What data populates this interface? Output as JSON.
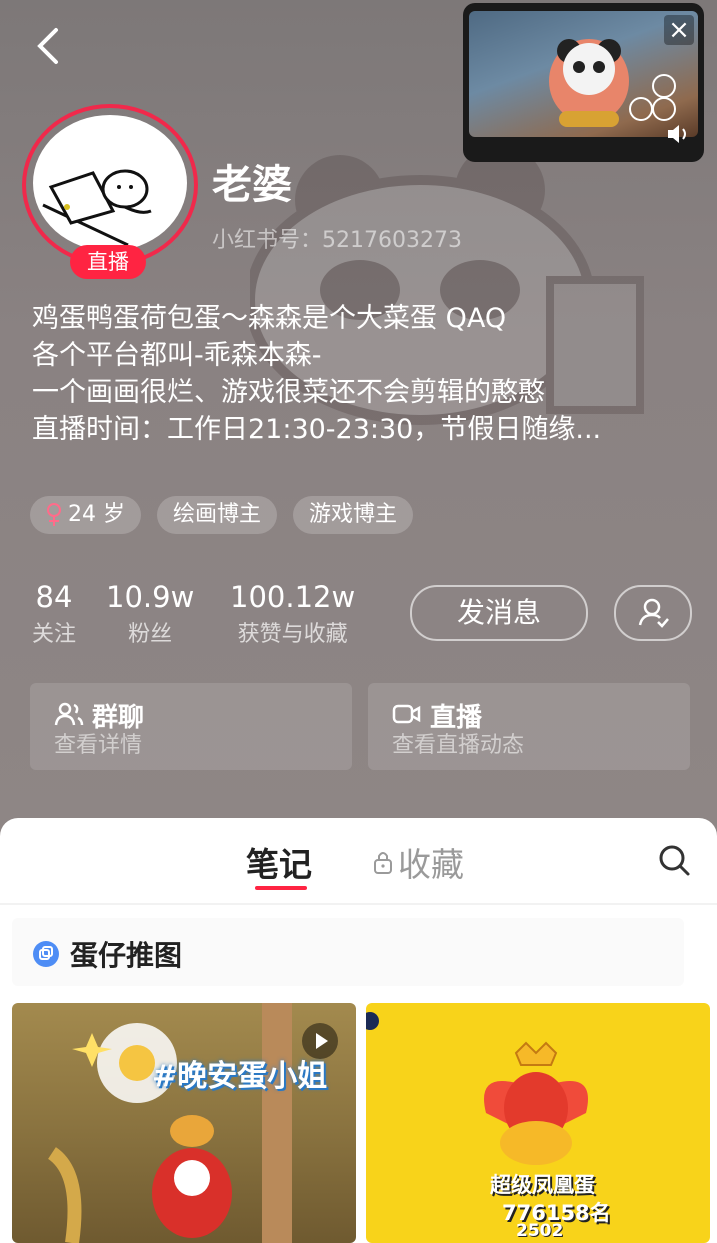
{
  "profile": {
    "nickname": "老婆",
    "red_id": "小红书号：5217603273",
    "live_badge": "直播",
    "bio_lines": [
      "鸡蛋鸭蛋荷包蛋～森森是个大菜蛋 QAQ",
      "各个平台都叫-乖森本森-",
      "一个画画很烂、游戏很菜还不会剪辑的憨憨",
      "直播时间：工作日21:30-23:30，节假日随缘..."
    ],
    "tags": [
      "24 岁",
      "绘画博主",
      "游戏博主"
    ],
    "tag_icon": "female-icon"
  },
  "stats": [
    {
      "value": "84",
      "label": "关注"
    },
    {
      "value": "10.9w",
      "label": "粉丝"
    },
    {
      "value": "100.12w",
      "label": "获赞与收藏"
    }
  ],
  "actions": {
    "message_label": "发消息"
  },
  "cards": {
    "group": {
      "title": "群聊",
      "sub": "查看详情"
    },
    "live": {
      "title": "直播",
      "sub": "查看直播动态"
    }
  },
  "tabs": {
    "notes": "笔记",
    "favorites": "收藏"
  },
  "collection": {
    "label": "蛋仔推图"
  },
  "notes": [
    {
      "overlay_text": "#晚安蛋小姐"
    },
    {
      "egg_name": "超级凤凰蛋",
      "rank": "776158名",
      "count": "2502"
    }
  ],
  "colors": {
    "accent": "#ff2442",
    "header_bg": "#8a8282"
  }
}
